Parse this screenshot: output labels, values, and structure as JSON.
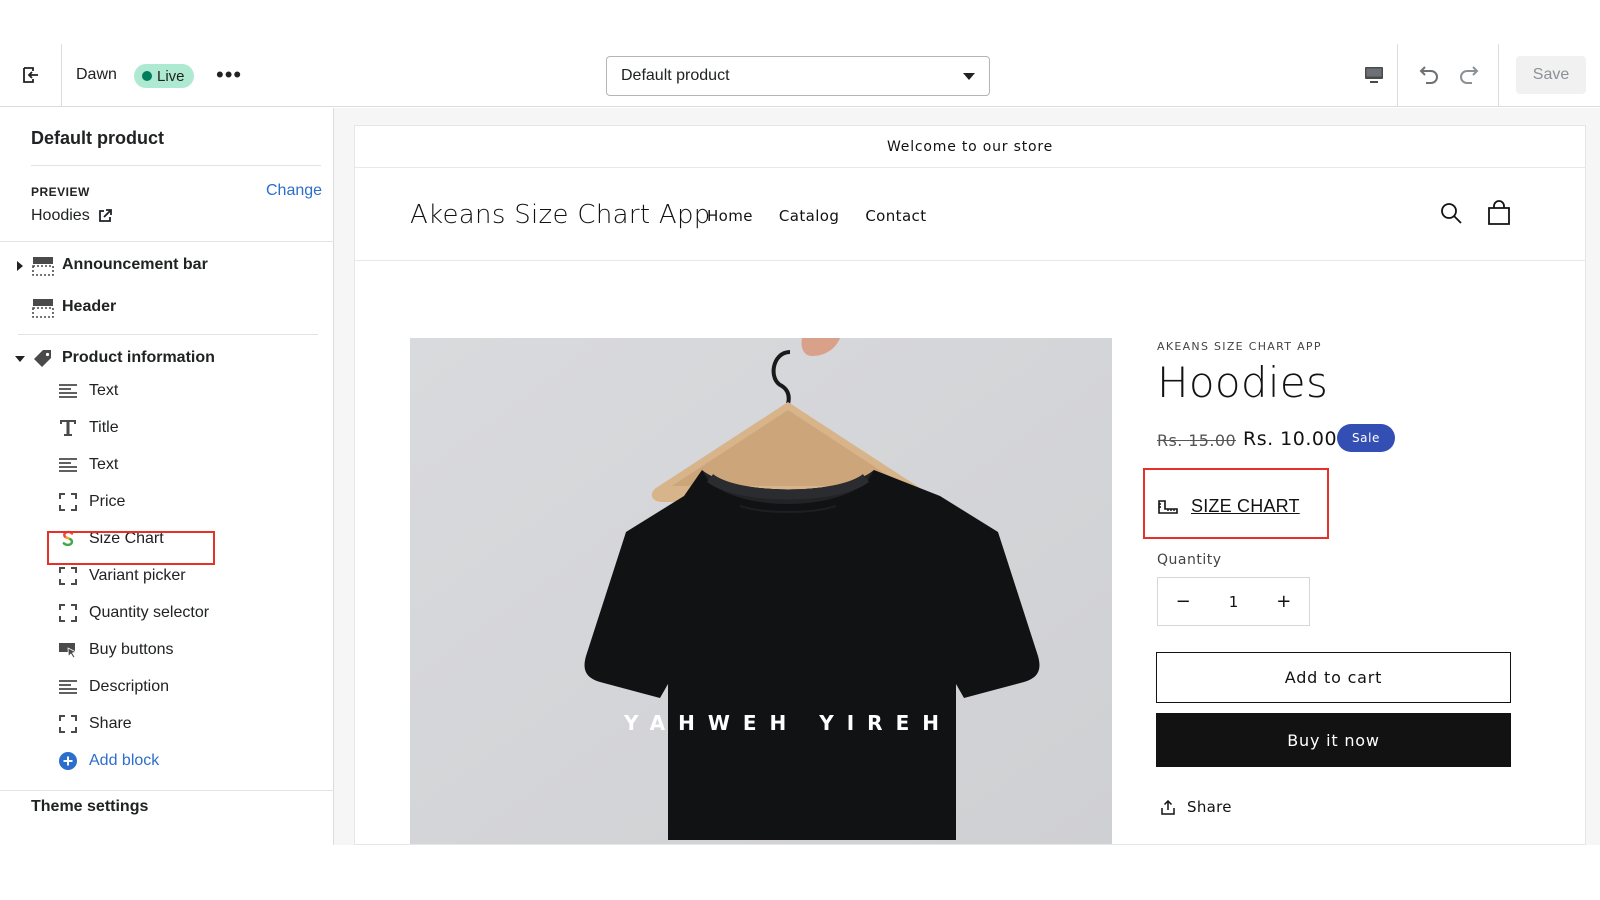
{
  "toolbar": {
    "theme_name": "Dawn",
    "status_badge": "Live",
    "more_label": "•••",
    "template_select_value": "Default product",
    "save_label": "Save"
  },
  "sidebar": {
    "title": "Default product",
    "preview_label": "PREVIEW",
    "preview_change": "Change",
    "preview_value": "Hoodies",
    "sections": [
      {
        "label": "Announcement bar",
        "icon": "layout-section-icon"
      },
      {
        "label": "Header",
        "icon": "layout-section-icon"
      },
      {
        "label": "Product information",
        "icon": "tag-icon"
      }
    ],
    "blocks": [
      {
        "label": "Text",
        "icon": "text-align-icon"
      },
      {
        "label": "Title",
        "icon": "title-icon"
      },
      {
        "label": "Text",
        "icon": "text-align-icon"
      },
      {
        "label": "Price",
        "icon": "block-frame-icon"
      },
      {
        "label": "Size Chart",
        "icon": "app-s-icon"
      },
      {
        "label": "Variant picker",
        "icon": "block-frame-icon"
      },
      {
        "label": "Quantity selector",
        "icon": "block-frame-icon"
      },
      {
        "label": "Buy buttons",
        "icon": "buy-button-icon"
      },
      {
        "label": "Description",
        "icon": "text-align-icon"
      },
      {
        "label": "Share",
        "icon": "block-frame-icon"
      }
    ],
    "add_block": "Add block",
    "theme_settings": "Theme settings"
  },
  "store": {
    "announcement": "Welcome to our store",
    "logo": "Akeans Size Chart App",
    "nav": [
      "Home",
      "Catalog",
      "Contact"
    ],
    "product": {
      "vendor": "AKEANS SIZE CHART APP",
      "title": "Hoodies",
      "price_old": "Rs. 15.00",
      "price_new": "Rs. 10.00",
      "sale_badge": "Sale",
      "size_chart_label": "SIZE CHART",
      "quantity_label": "Quantity",
      "quantity_minus": "−",
      "quantity_value": "1",
      "quantity_plus": "+",
      "add_to_cart": "Add to cart",
      "buy_now": "Buy it now",
      "share": "Share",
      "shirt_print": "YAHWEH YIREH"
    }
  },
  "colors": {
    "accent_link": "#2c6ecb",
    "live_badge_bg": "#aee9d1",
    "sale_badge_bg": "#334fb4",
    "highlight_box": "#e4322b",
    "buy_button_bg": "#121212"
  }
}
